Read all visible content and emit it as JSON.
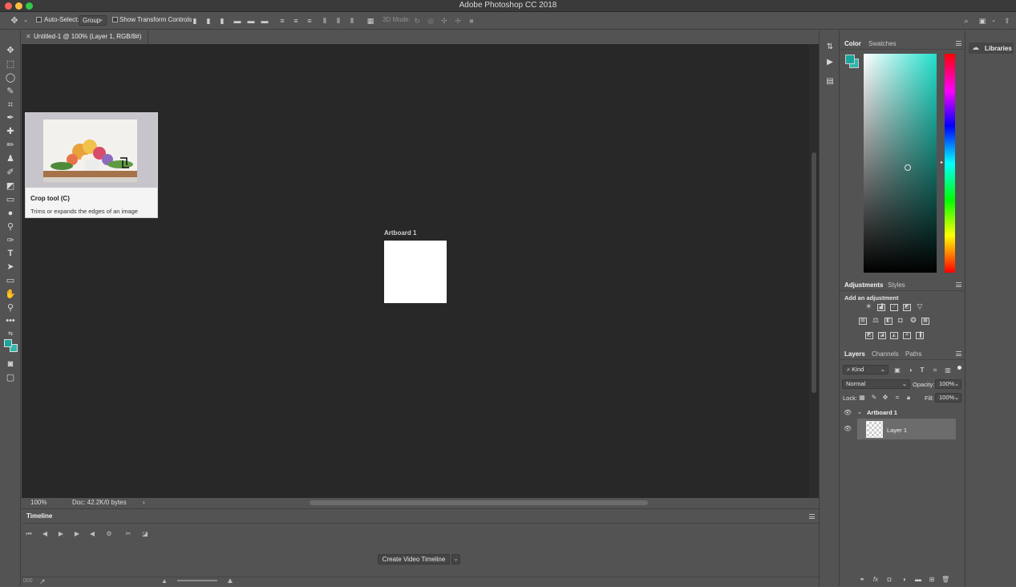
{
  "app": {
    "title": "Adobe Photoshop CC 2018"
  },
  "colors": {
    "accent_fg": "#1aa59c",
    "accent_bg": "#2fb8ae",
    "canvas_bg": "#282828",
    "panel_bg": "#535353"
  },
  "options_bar": {
    "auto_select_label": "Auto-Select:",
    "auto_select_value": "Group",
    "show_transform_label": "Show Transform Controls",
    "mode_3d_label": "3D Mode:"
  },
  "document": {
    "tab_label": "Untitled-1 @ 100% (Layer 1, RGB/8#)",
    "artboard_label": "Artboard 1",
    "zoom": "100%",
    "doc_info": "Doc: 42.2K/0 bytes"
  },
  "tooltip": {
    "title": "Crop tool (C)",
    "description": "Trims or expands the edges of an image"
  },
  "timeline": {
    "title": "Timeline",
    "create_button": "Create Video Timeline"
  },
  "color_panel": {
    "tabs": [
      "Color",
      "Swatches"
    ],
    "active": "Color"
  },
  "adjustments_panel": {
    "tabs": [
      "Adjustments",
      "Styles"
    ],
    "subtitle": "Add an adjustment"
  },
  "layers_panel": {
    "tabs": [
      "Layers",
      "Channels",
      "Paths"
    ],
    "kind_label": "Kind",
    "blend_mode": "Normal",
    "opacity_label": "Opacity:",
    "opacity_value": "100%",
    "lock_label": "Lock:",
    "fill_label": "Fill:",
    "fill_value": "100%",
    "layers": [
      {
        "name": "Artboard 1",
        "type": "artboard"
      },
      {
        "name": "Layer 1",
        "type": "layer"
      }
    ]
  },
  "libraries": {
    "label": "Libraries"
  }
}
